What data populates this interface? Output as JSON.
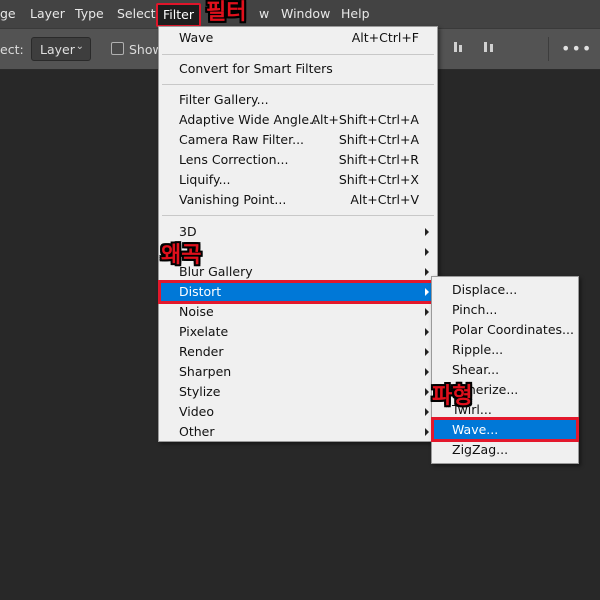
{
  "menubar": {
    "items": [
      "ge",
      "Layer",
      "Type",
      "Select",
      "Filter",
      "w",
      "Window",
      "Help"
    ]
  },
  "optbar": {
    "select_label": "ect:",
    "layer_select": "Layer",
    "show_label": "Show",
    "more": "•••"
  },
  "filter_menu": {
    "last_filter": {
      "label": "Wave",
      "shortcut": "Alt+Ctrl+F"
    },
    "convert": {
      "label": "Convert for Smart Filters"
    },
    "gallery_items": [
      {
        "label": "Filter Gallery...",
        "shortcut": ""
      },
      {
        "label": "Adaptive Wide Angle...",
        "shortcut": "Alt+Shift+Ctrl+A"
      },
      {
        "label": "Camera Raw Filter...",
        "shortcut": "Shift+Ctrl+A"
      },
      {
        "label": "Lens Correction...",
        "shortcut": "Shift+Ctrl+R"
      },
      {
        "label": "Liquify...",
        "shortcut": "Shift+Ctrl+X"
      },
      {
        "label": "Vanishing Point...",
        "shortcut": "Alt+Ctrl+V"
      }
    ],
    "submenus": [
      "3D",
      "",
      "Blur Gallery",
      "Distort",
      "Noise",
      "Pixelate",
      "Render",
      "Sharpen",
      "Stylize",
      "Video",
      "Other"
    ]
  },
  "distort_menu": {
    "items": [
      "Displace...",
      "Pinch...",
      "Polar Coordinates...",
      "Ripple...",
      "Shear...",
      "Spherize...",
      "Twirl...",
      "Wave...",
      "ZigZag..."
    ]
  },
  "annotations": {
    "filter": "필터",
    "distort": "왜곡",
    "wave": "파형"
  },
  "colors": {
    "highlight": "#0078d7",
    "annotation_red": "#e0101c"
  }
}
